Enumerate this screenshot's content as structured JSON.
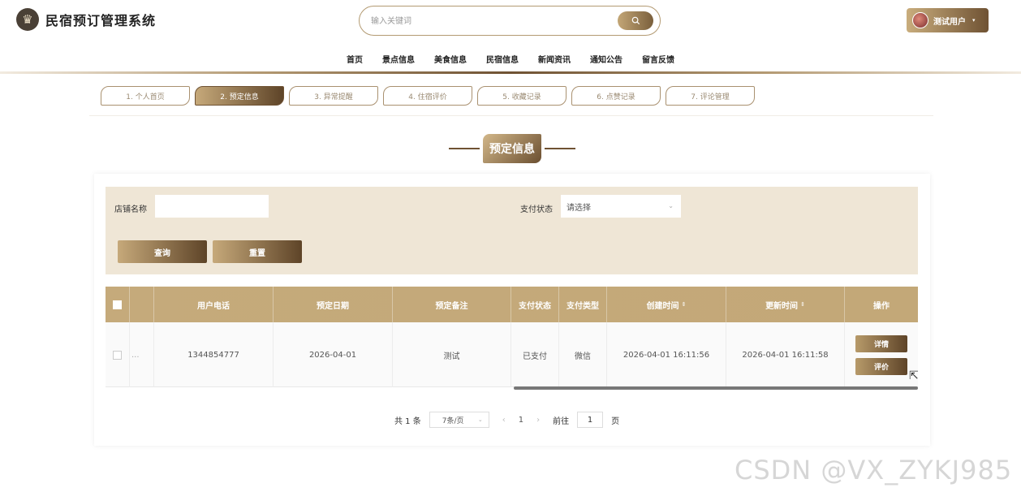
{
  "app": {
    "title": "民宿预订管理系统",
    "logo_glyph": "♛"
  },
  "search": {
    "placeholder": "输入关键词",
    "icon": "search-icon"
  },
  "user": {
    "name": "测试用户",
    "caret": "▾"
  },
  "nav": [
    "首页",
    "景点信息",
    "美食信息",
    "民宿信息",
    "新闻资讯",
    "通知公告",
    "留言反馈"
  ],
  "tabs": [
    "1. 个人首页",
    "2. 预定信息",
    "3. 异常提醒",
    "4. 住宿评价",
    "5. 收藏记录",
    "6. 点赞记录",
    "7. 评论管理"
  ],
  "active_tab_index": 1,
  "section_title": "预定信息",
  "filters": {
    "shop_name_label": "店铺名称",
    "shop_name_value": "",
    "pay_status_label": "支付状态",
    "pay_status_value": "请选择",
    "query_label": "查询",
    "reset_label": "重置"
  },
  "table": {
    "headers": [
      "用户电话",
      "预定日期",
      "预定备注",
      "支付状态",
      "支付类型",
      "创建时间",
      "更新时间",
      "操作"
    ],
    "sortable": [
      "创建时间",
      "更新时间"
    ],
    "rows": [
      {
        "phone": "1344854777",
        "date": "2026-04-01",
        "note": "测试",
        "pay_status": "已支付",
        "pay_type": "微信",
        "created": "2026-04-01 16:11:56",
        "updated": "2026-04-01 16:11:58",
        "row_marker": "...",
        "ops": [
          "详情",
          "评价"
        ]
      }
    ]
  },
  "pagination": {
    "total": "共 1 条",
    "page_size": "7条/页",
    "prev": "‹",
    "current": "1",
    "next": "›",
    "goto_label": "前往",
    "goto_value": "1",
    "page_suffix": "页"
  },
  "watermark": "CSDN @VX_ZYKJ985",
  "colors": {
    "accent_light": "#c6a97a",
    "accent_dark": "#5e4428",
    "filter_bg": "#efe6d6"
  }
}
